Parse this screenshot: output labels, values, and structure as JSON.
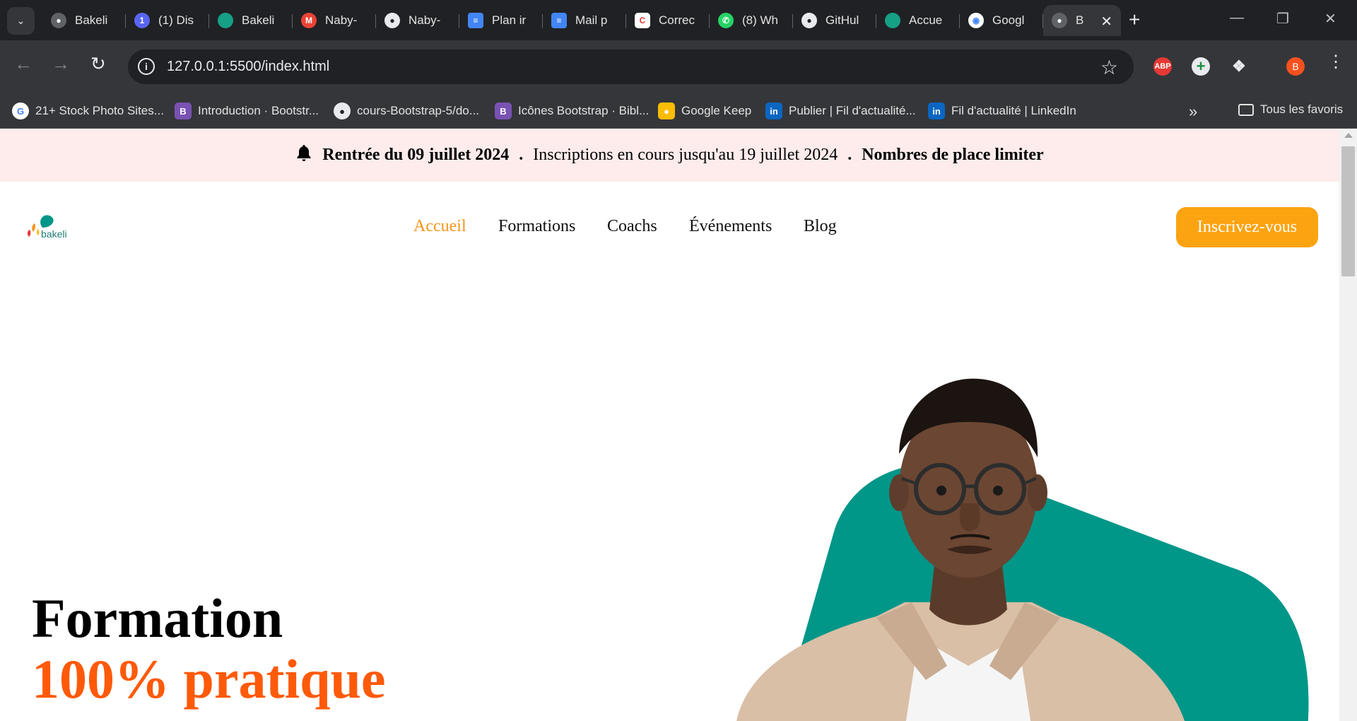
{
  "browser": {
    "tabs": [
      {
        "label": "Bakeli",
        "icon": "globe-icon",
        "color": "#5f6368"
      },
      {
        "label": "(1) Dis",
        "icon": "discord-icon",
        "color": "#5865f2"
      },
      {
        "label": "Bakeli",
        "icon": "bakeli-favicon",
        "color": "#16a085"
      },
      {
        "label": "Naby-",
        "icon": "gmail-icon",
        "color": "#ea4335"
      },
      {
        "label": "Naby-",
        "icon": "github-icon",
        "color": "#ffffff"
      },
      {
        "label": "Plan ir",
        "icon": "google-docs-icon",
        "color": "#4285f4"
      },
      {
        "label": "Mail p",
        "icon": "google-docs-icon",
        "color": "#4285f4"
      },
      {
        "label": "Correc",
        "icon": "corrector-icon",
        "color": "#ffffff"
      },
      {
        "label": "(8) Wh",
        "icon": "whatsapp-icon",
        "color": "#25d366"
      },
      {
        "label": "GitHul",
        "icon": "github-icon",
        "color": "#ffffff"
      },
      {
        "label": "Accue",
        "icon": "bakeli-favicon",
        "color": "#16a085"
      },
      {
        "label": "Googl",
        "icon": "google-lens-icon",
        "color": "#4285f4"
      },
      {
        "label": "B",
        "icon": "globe-icon",
        "color": "#5f6368",
        "active": true
      }
    ],
    "url": "127.0.0.1:5500/index.html",
    "profile_initial": "B",
    "abp_label": "ABP",
    "bookmarks": [
      {
        "label": "21+ Stock Photo Sites...",
        "icon": "google-icon"
      },
      {
        "label": "Introduction · Bootstr...",
        "icon": "bootstrap-icon"
      },
      {
        "label": "cours-Bootstrap-5/do...",
        "icon": "github-icon"
      },
      {
        "label": "Icônes Bootstrap · Bibl...",
        "icon": "bootstrap-icon"
      },
      {
        "label": "Google Keep",
        "icon": "google-keep-icon"
      },
      {
        "label": "Publier | Fil d'actualité...",
        "icon": "linkedin-icon"
      },
      {
        "label": "Fil d'actualité | LinkedIn",
        "icon": "linkedin-icon"
      }
    ],
    "all_bookmarks_label": "Tous les favoris"
  },
  "announcement": {
    "part1": "Rentrée du 09 juillet 2024",
    "sep": ".",
    "part2": "Inscriptions en cours jusqu'au 19 juillet 2024",
    "part3": "Nombres de place limiter"
  },
  "site": {
    "logo_text": "bakeli",
    "nav": [
      "Accueil",
      "Formations",
      "Coachs",
      "Événements",
      "Blog"
    ],
    "active_nav": "Accueil",
    "cta_label": "Inscrivez-vous"
  },
  "hero": {
    "line1": "Formation",
    "line2": "100% pratique"
  },
  "colors": {
    "accent_orange": "#f7941d",
    "cta": "#fca311",
    "hero_accent": "#ff5a0a",
    "teal": "#009688",
    "banner_bg": "#fdeceb"
  }
}
